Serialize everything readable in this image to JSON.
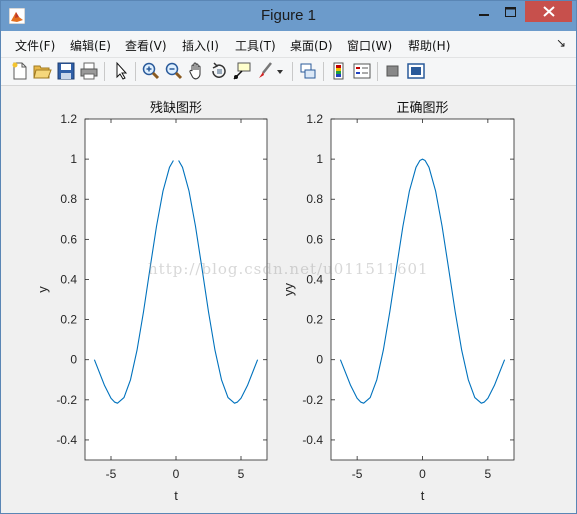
{
  "window": {
    "title": "Figure 1",
    "min_symbol": "—",
    "max_symbol": "□",
    "close_symbol": "✕"
  },
  "menu": {
    "items": [
      "文件(F)",
      "编辑(E)",
      "查看(V)",
      "插入(I)",
      "工具(T)",
      "桌面(D)",
      "窗口(W)",
      "帮助(H)"
    ],
    "dock_symbol": "↘"
  },
  "toolbar": {
    "icons": [
      "new-figure-icon",
      "open-file-icon",
      "save-icon",
      "print-icon",
      "edit-plot-arrow-icon",
      "zoom-in-icon",
      "zoom-out-icon",
      "pan-hand-icon",
      "rotate-3d-icon",
      "data-cursor-icon",
      "brush-icon",
      "link-plot-icon",
      "insert-colorbar-icon",
      "insert-legend-icon",
      "hide-plot-tools-icon",
      "show-plot-tools-icon"
    ]
  },
  "watermark": "http://blog.csdn.net/u011511601",
  "colors": {
    "titlebar": "#6c9bcb",
    "line": "#0072bd",
    "close": "#c7504c"
  },
  "chart_data": [
    {
      "type": "line",
      "title": "残缺图形",
      "xlabel": "t",
      "ylabel": "y",
      "xlim": [
        -7,
        7
      ],
      "ylim": [
        -0.5,
        1.2
      ],
      "xticks": [
        "-5",
        "0",
        "5"
      ],
      "xtick_values": [
        -5,
        0,
        5
      ],
      "yticks": [
        "-0.4",
        "-0.2",
        "0",
        "0.2",
        "0.4",
        "0.6",
        "0.8",
        "1",
        "1.2"
      ],
      "ytick_values": [
        -0.4,
        -0.2,
        0,
        0.2,
        0.4,
        0.6,
        0.8,
        1,
        1.2
      ],
      "x": [
        -6.28,
        -5.5,
        -5.0,
        -4.71,
        -4.5,
        -4.0,
        -3.5,
        -3.0,
        -2.5,
        -2.0,
        -1.5,
        -1.0,
        -0.5,
        -0.2,
        0.2,
        0.5,
        1.0,
        1.5,
        2.0,
        2.5,
        3.0,
        3.5,
        4.0,
        4.5,
        4.71,
        5.0,
        5.5,
        6.28
      ],
      "y": [
        0.0,
        -0.128,
        -0.192,
        -0.212,
        -0.217,
        -0.189,
        -0.1,
        0.047,
        0.239,
        0.455,
        0.665,
        0.841,
        0.959,
        0.993,
        0.993,
        0.959,
        0.841,
        0.665,
        0.455,
        0.239,
        0.047,
        -0.1,
        -0.189,
        -0.217,
        -0.212,
        -0.192,
        -0.128,
        0.0
      ],
      "gap_after_index": 13
    },
    {
      "type": "line",
      "title": "正确图形",
      "xlabel": "t",
      "ylabel": "yy",
      "xlim": [
        -7,
        7
      ],
      "ylim": [
        -0.5,
        1.2
      ],
      "xticks": [
        "-5",
        "0",
        "5"
      ],
      "xtick_values": [
        -5,
        0,
        5
      ],
      "yticks": [
        "-0.4",
        "-0.2",
        "0",
        "0.2",
        "0.4",
        "0.6",
        "0.8",
        "1",
        "1.2"
      ],
      "ytick_values": [
        -0.4,
        -0.2,
        0,
        0.2,
        0.4,
        0.6,
        0.8,
        1,
        1.2
      ],
      "x": [
        -6.28,
        -5.5,
        -5.0,
        -4.71,
        -4.5,
        -4.0,
        -3.5,
        -3.0,
        -2.5,
        -2.0,
        -1.5,
        -1.0,
        -0.5,
        -0.2,
        0.0,
        0.2,
        0.5,
        1.0,
        1.5,
        2.0,
        2.5,
        3.0,
        3.5,
        4.0,
        4.5,
        4.71,
        5.0,
        5.5,
        6.28
      ],
      "y": [
        0.0,
        -0.128,
        -0.192,
        -0.212,
        -0.217,
        -0.189,
        -0.1,
        0.047,
        0.239,
        0.455,
        0.665,
        0.841,
        0.959,
        0.993,
        1.0,
        0.993,
        0.959,
        0.841,
        0.665,
        0.455,
        0.239,
        0.047,
        -0.1,
        -0.189,
        -0.217,
        -0.212,
        -0.192,
        -0.128,
        0.0
      ]
    }
  ]
}
